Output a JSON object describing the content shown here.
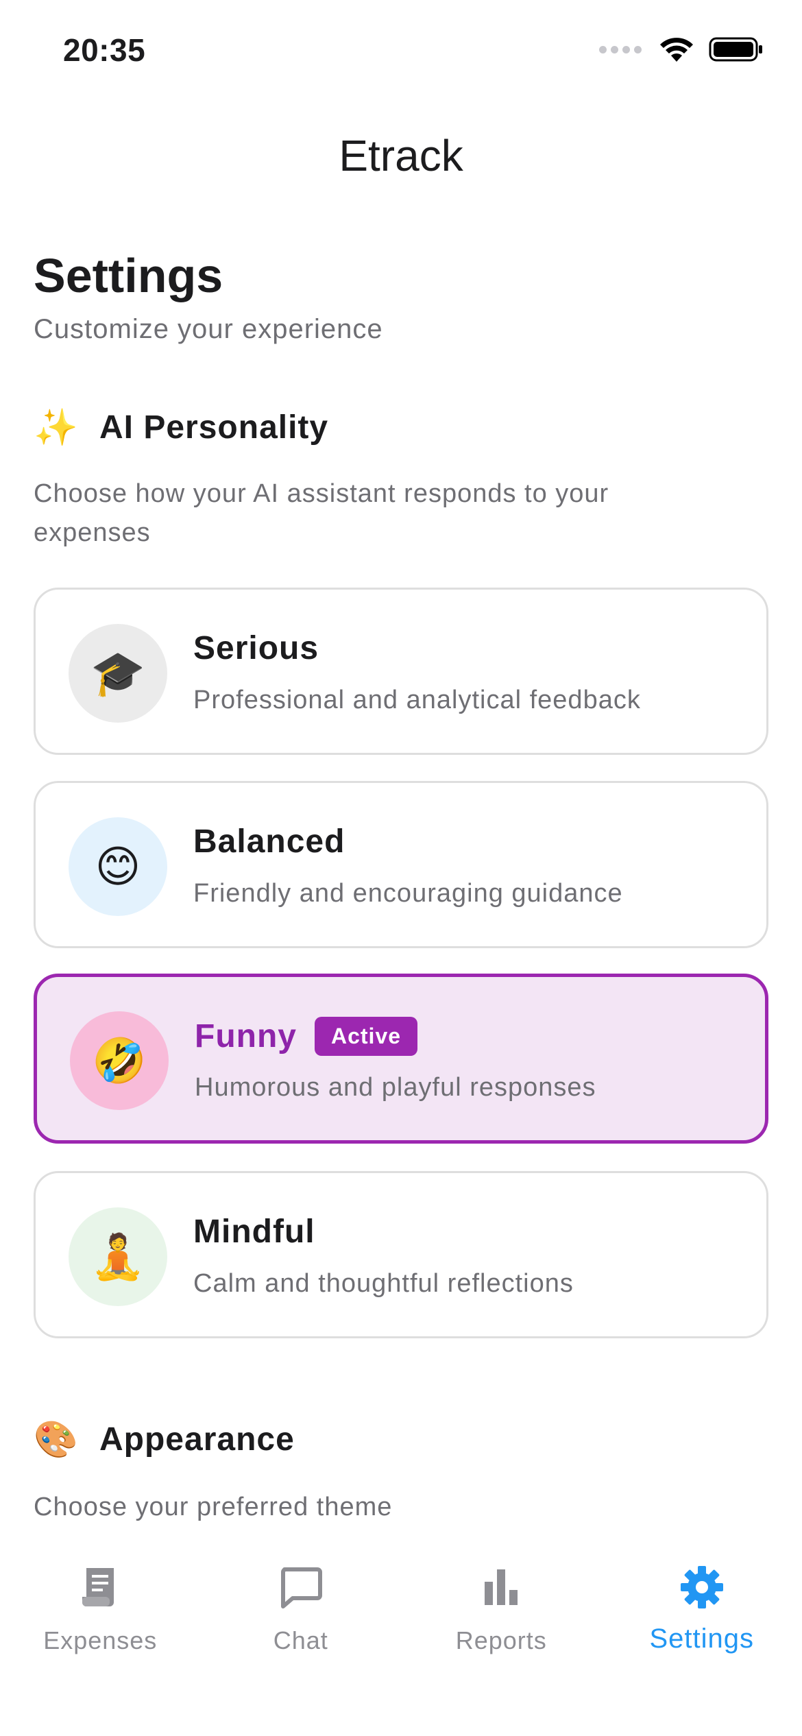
{
  "status": {
    "time": "20:35"
  },
  "app": {
    "title": "Etrack"
  },
  "page": {
    "heading": "Settings",
    "subtitle": "Customize your experience"
  },
  "ai_section": {
    "emoji": "✨",
    "title": "AI Personality",
    "description": "Choose how your AI assistant responds to your expenses",
    "options": [
      {
        "emoji": "🎓",
        "title": "Serious",
        "description": "Professional and analytical feedback",
        "avatar_bg": "#ebebeb",
        "active": false
      },
      {
        "emoji": "😊",
        "title": "Balanced",
        "description": "Friendly and encouraging guidance",
        "avatar_bg": "#e3f2fd",
        "active": false
      },
      {
        "emoji": "🤣",
        "title": "Funny",
        "description": "Humorous and playful responses",
        "avatar_bg": "#f8bbd9",
        "active": true,
        "badge": "Active"
      },
      {
        "emoji": "🧘",
        "title": "Mindful",
        "description": "Calm and thoughtful reflections",
        "avatar_bg": "#e8f5e9",
        "active": false
      }
    ]
  },
  "appearance_section": {
    "emoji": "🎨",
    "title": "Appearance",
    "description": "Choose your preferred theme"
  },
  "tabs": [
    {
      "label": "Expenses",
      "icon": "receipt-icon",
      "selected": false
    },
    {
      "label": "Chat",
      "icon": "chat-bubble-icon",
      "selected": false
    },
    {
      "label": "Reports",
      "icon": "bar-chart-icon",
      "selected": false
    },
    {
      "label": "Settings",
      "icon": "gear-icon",
      "selected": true
    }
  ],
  "colors": {
    "accent": "#9c27b0",
    "active_bg": "#f3e5f5",
    "tab_selected": "#2196f3",
    "tab_inactive": "#8e8e93"
  }
}
